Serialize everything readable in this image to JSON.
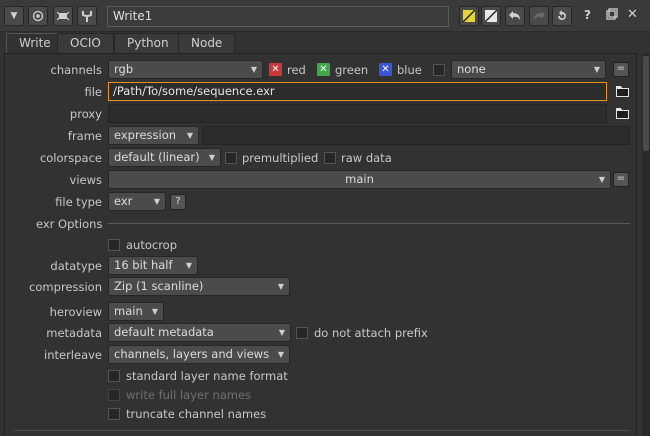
{
  "header": {
    "node_name": "Write1",
    "help": "?",
    "icons": [
      "collapse-arrow-icon",
      "viewer-icon",
      "node-toggle-icon",
      "wrench-icon",
      "color-swatch-icon",
      "slash-icon",
      "undo-icon",
      "redo-icon",
      "revert-icon",
      "help-icon",
      "float-window-icon",
      "close-icon"
    ]
  },
  "tabs": [
    "Write",
    "OCIO",
    "Python",
    "Node"
  ],
  "form": {
    "channels": {
      "label": "channels",
      "value": "rgb",
      "red": "red",
      "green": "green",
      "blue": "blue",
      "alpha_value": "none",
      "eq": "="
    },
    "file": {
      "label": "file",
      "value": "/Path/To/some/sequence.exr"
    },
    "proxy": {
      "label": "proxy",
      "value": ""
    },
    "frame": {
      "label": "frame",
      "mode": "expression",
      "value": ""
    },
    "colorspace": {
      "label": "colorspace",
      "value": "default (linear)",
      "premultiplied": "premultiplied",
      "raw_data": "raw data"
    },
    "views": {
      "label": "views",
      "value": "main",
      "eq": "="
    },
    "file_type": {
      "label": "file type",
      "value": "exr",
      "help": "?"
    },
    "exr_options": "exr Options",
    "autocrop": "autocrop",
    "datatype": {
      "label": "datatype",
      "value": "16 bit half"
    },
    "compression": {
      "label": "compression",
      "value": "Zip (1 scanline)"
    },
    "heroview": {
      "label": "heroview",
      "value": "main"
    },
    "metadata": {
      "label": "metadata",
      "value": "default metadata",
      "no_prefix": "do not attach prefix"
    },
    "interleave": {
      "label": "interleave",
      "value": "channels, layers and views"
    },
    "standard_layer": "standard layer name format",
    "write_full": "write full layer names",
    "truncate": "truncate channel names"
  },
  "colors": {
    "accent_focus": "#e09720",
    "red_mark": "#c9383b",
    "green_mark": "#3ea84a",
    "blue_mark": "#3a55d6",
    "yellow_swatch": "#e3d43a"
  }
}
